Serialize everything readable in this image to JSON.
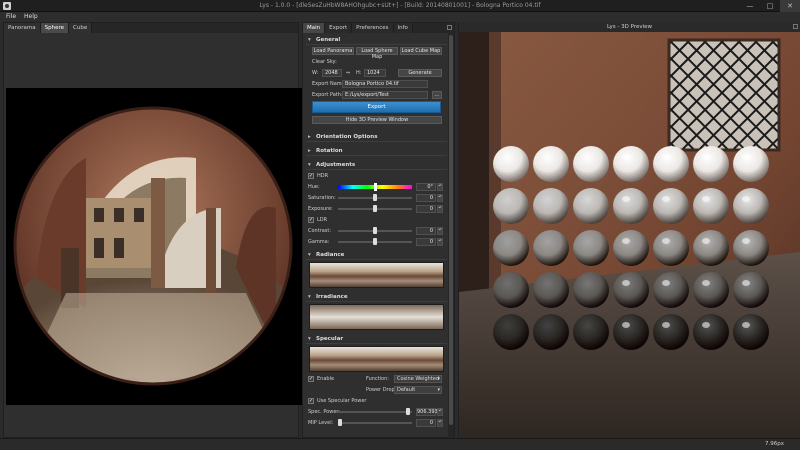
{
  "window": {
    "title": "Lys - 1.0.0 - [dleSesZuHbW8AHOhgubc+sUt+] - [Build: 20140801001] - Bologna Portico 04.tif",
    "controls": [
      "—",
      "□",
      "✕"
    ]
  },
  "menu": [
    "File",
    "Help"
  ],
  "left_tabs": [
    {
      "label": "Panorama",
      "active": false
    },
    {
      "label": "Sphere",
      "active": true
    },
    {
      "label": "Cube",
      "active": false
    }
  ],
  "mid_tabs": [
    {
      "label": "Main",
      "active": true
    },
    {
      "label": "Export",
      "active": false
    },
    {
      "label": "Preferences",
      "active": false
    },
    {
      "label": "Info",
      "active": false
    }
  ],
  "general": {
    "header": "General",
    "load_panorama": "Load Panorama",
    "load_sphere_map": "Load Sphere Map",
    "load_cube_map": "Load Cube Map",
    "clear_sky_label": "Clear Sky:",
    "w_label": "W:",
    "width_value": "2048",
    "h_label": "H:",
    "height_value": "1024",
    "generate": "Generate",
    "export_name_label": "Export Name:",
    "export_name_value": "Bologna Portico 04.tif",
    "export_path_label": "Export Path:",
    "export_path_value": "E:/Lys/export/Test",
    "browse": "...",
    "export_button": "Export",
    "hide_preview": "Hide 3D Preview Window"
  },
  "sections": {
    "orientation": "Orientation Options",
    "rotation": "Rotation"
  },
  "adjustments": {
    "header": "Adjustments",
    "hdr_label": "HDR",
    "hue_label": "Hue:",
    "hue_value": "0°",
    "saturation_label": "Saturation:",
    "saturation_value": "0",
    "exposure_label": "Exposure:",
    "exposure_value": "0",
    "ldr_label": "LDR",
    "contrast_label": "Contrast:",
    "contrast_value": "0",
    "gamma_label": "Gamma:",
    "gamma_value": "0"
  },
  "radiance": {
    "header": "Radiance"
  },
  "irradiance": {
    "header": "Irradiance"
  },
  "specular": {
    "header": "Specular",
    "enable_label": "Enable",
    "function_label": "Function:",
    "function_value": "Cosine Weighted",
    "power_drop_label": "Power Drop:",
    "power_drop_value": "Default",
    "use_spec_power_label": "Use Specular Power",
    "spec_power_label": "Spec. Power:",
    "spec_power_value": "906.393",
    "mip_level_label": "MIP Level:",
    "mip_level_value": "0"
  },
  "preview": {
    "title": "Lys - 3D Preview",
    "rows": 5,
    "cols": 7
  },
  "status": {
    "fps": "7.96px"
  },
  "colors": {
    "accent": "#2a7fc4",
    "panel": "#2f2f2f",
    "wall": "#7a4a35"
  }
}
